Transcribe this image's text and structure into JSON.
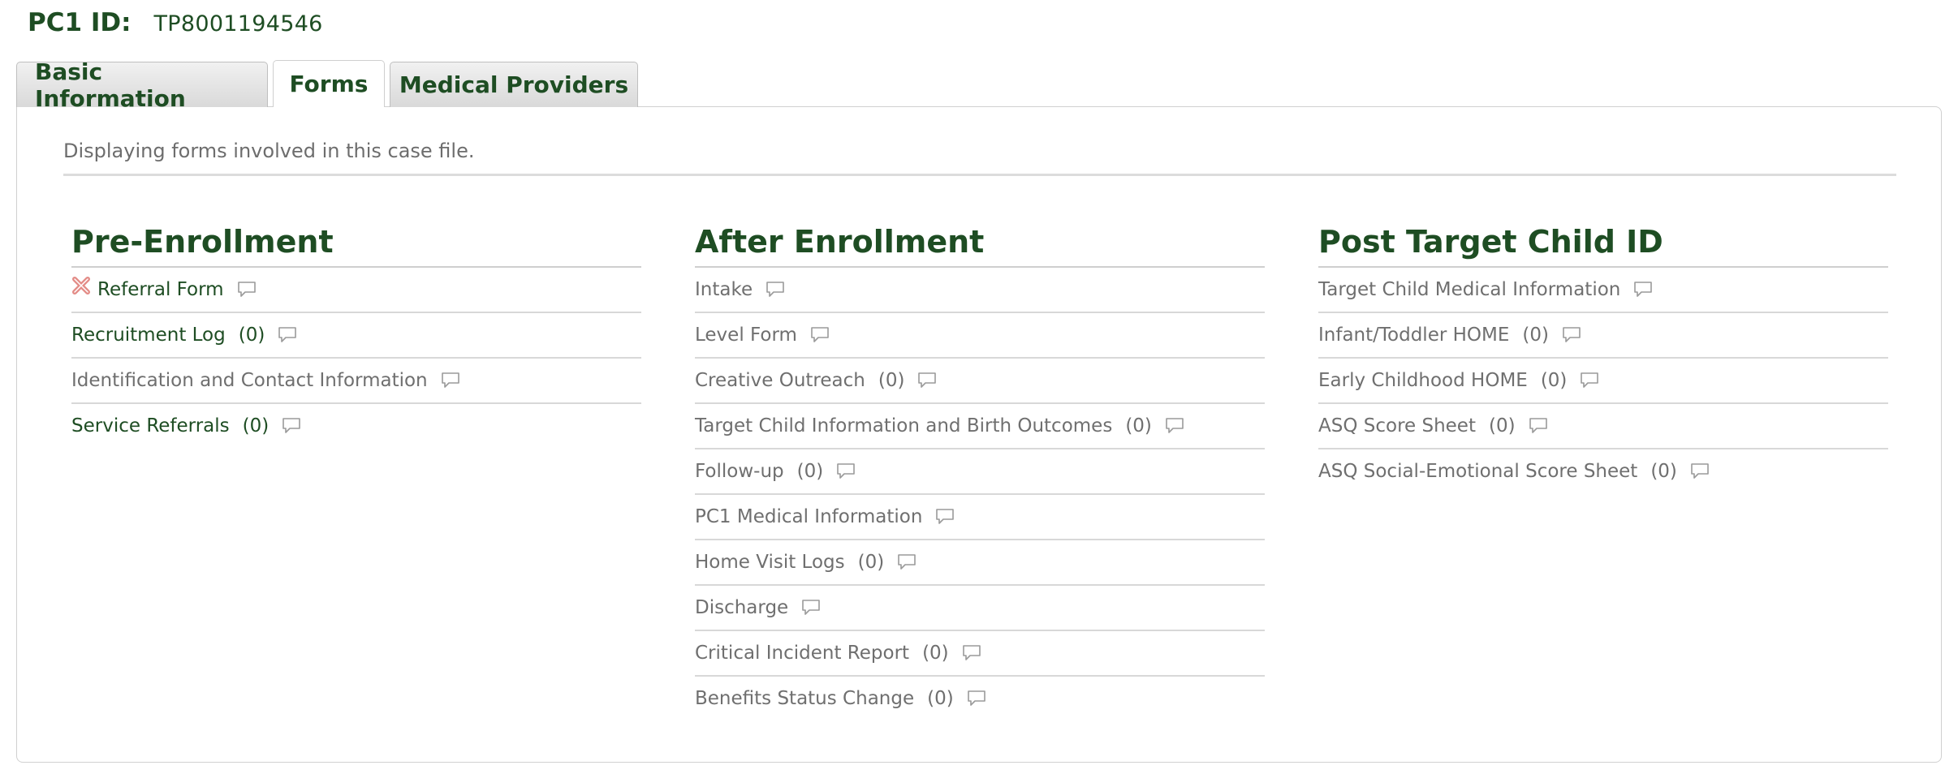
{
  "header": {
    "label": "PC1 ID:",
    "value": "TP8001194546"
  },
  "tabs": [
    {
      "label": "Basic Information",
      "active": false
    },
    {
      "label": "Forms",
      "active": true
    },
    {
      "label": "Medical Providers",
      "active": false
    }
  ],
  "panel": {
    "description": "Displaying forms involved in this case file."
  },
  "colors": {
    "brand_green": "#1e4d23",
    "muted_text": "#6f6f6f",
    "delete_icon": "#d9534f"
  },
  "columns": [
    {
      "title": "Pre-Enrollment",
      "items": [
        {
          "label": "Referral Form",
          "count": "",
          "style": "green",
          "delete_icon": true,
          "icon": "comment-icon"
        },
        {
          "label": "Recruitment Log",
          "count": "(0)",
          "style": "green",
          "icon": "comment-icon"
        },
        {
          "label": "Identification and Contact Information",
          "count": "",
          "style": "muted",
          "icon": "comment-icon"
        },
        {
          "label": "Service Referrals",
          "count": "(0)",
          "style": "green",
          "icon": "comment-icon"
        }
      ]
    },
    {
      "title": "After Enrollment",
      "items": [
        {
          "label": "Intake",
          "count": "",
          "icon": "comment-icon"
        },
        {
          "label": "Level Form",
          "count": "",
          "icon": "comment-icon"
        },
        {
          "label": "Creative Outreach",
          "count": "(0)",
          "icon": "comment-icon"
        },
        {
          "label": "Target Child Information and Birth Outcomes",
          "count": "(0)",
          "icon": "comment-icon"
        },
        {
          "label": "Follow-up",
          "count": "(0)",
          "icon": "comment-icon"
        },
        {
          "label": "PC1 Medical Information",
          "count": "",
          "icon": "comment-icon"
        },
        {
          "label": "Home Visit Logs",
          "count": "(0)",
          "icon": "comment-icon"
        },
        {
          "label": "Discharge",
          "count": "",
          "icon": "comment-icon"
        },
        {
          "label": "Critical Incident Report",
          "count": "(0)",
          "icon": "comment-icon"
        },
        {
          "label": "Benefits Status Change",
          "count": "(0)",
          "icon": "comment-icon"
        }
      ]
    },
    {
      "title": "Post Target Child ID",
      "items": [
        {
          "label": "Target Child Medical Information",
          "count": "",
          "icon": "comment-icon"
        },
        {
          "label": "Infant/Toddler HOME",
          "count": "(0)",
          "icon": "comment-icon"
        },
        {
          "label": "Early Childhood HOME",
          "count": "(0)",
          "icon": "comment-icon"
        },
        {
          "label": "ASQ Score Sheet",
          "count": "(0)",
          "icon": "comment-icon"
        },
        {
          "label": "ASQ Social-Emotional Score Sheet",
          "count": "(0)",
          "icon": "comment-icon"
        }
      ]
    }
  ]
}
